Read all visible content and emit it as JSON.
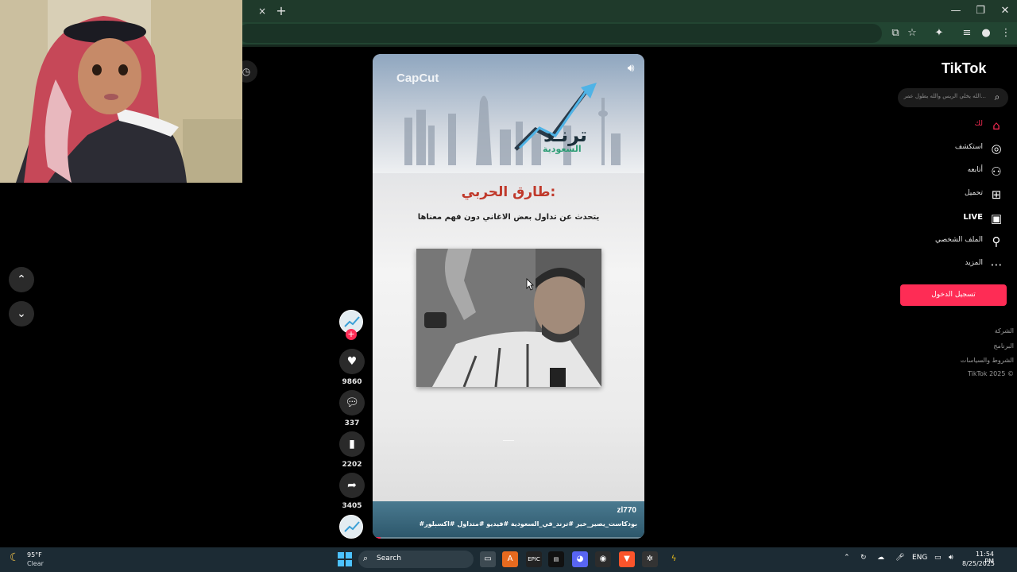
{
  "browser": {
    "tab_close": "×",
    "new_tab": "+",
    "window_controls": [
      "—",
      "❐",
      "✕"
    ]
  },
  "left_nav": {
    "up": "⌃",
    "down": "⌄"
  },
  "video": {
    "watermark": "CapCut",
    "brand_title": "ترنـد",
    "brand_subtitle": "السعودية",
    "headline": "طارق الحربي:",
    "subline": "يتحدث عن تداول بعض الاغاني دون فهم معناها",
    "caption_user": "zl770",
    "caption_tags": "#بودكاست_يصير_خير  #ترند_في_السعودية  #فيديو  #متداول  #اكسبلور",
    "progress_fraction": 0.03
  },
  "actions": {
    "likes": "9860",
    "comments": "337",
    "saves": "2202",
    "shares": "3405"
  },
  "sidebar": {
    "logo": "TikTok",
    "search_placeholder": "الله يخلي الريس والله يطول عمر...",
    "nav": [
      {
        "label": "لك",
        "icon": "home-icon",
        "active": true
      },
      {
        "label": "استكشف",
        "icon": "compass-icon",
        "active": false
      },
      {
        "label": "أتابعه",
        "icon": "following-icon",
        "active": false
      },
      {
        "label": "تحميل",
        "icon": "upload-icon",
        "active": false
      },
      {
        "label": "LIVE",
        "icon": "live-icon",
        "active": false
      },
      {
        "label": "الملف الشخصي",
        "icon": "profile-icon",
        "active": false
      },
      {
        "label": "المزيد",
        "icon": "more-icon",
        "active": false
      }
    ],
    "login_label": "تسجيل الدخول",
    "footer": [
      "الشركة",
      "البرنامج",
      "الشروط والسياسات",
      "TikTok 2025 ©"
    ]
  },
  "taskbar": {
    "weather_temp": "95°F",
    "weather_desc": "Clear",
    "search_label": "Search",
    "lang": "ENG",
    "time": "11:54 PM",
    "date": "8/25/2025"
  },
  "colors": {
    "accent": "#fe2c55",
    "chrome_title": "#1f3a2b",
    "taskbar": "#1c2b34"
  }
}
